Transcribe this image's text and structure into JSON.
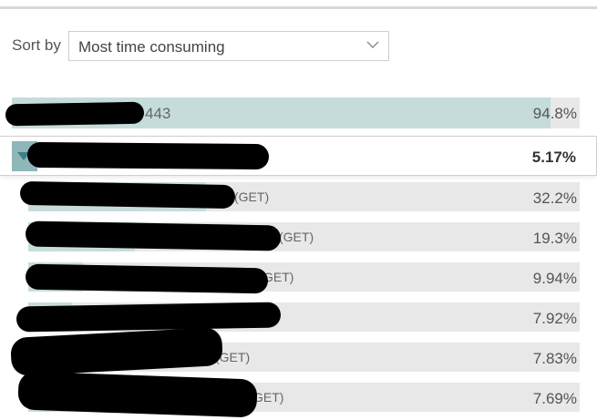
{
  "sort": {
    "label": "Sort by",
    "selected": "Most time consuming",
    "chevron_icon": "chevron-down-icon"
  },
  "rows": [
    {
      "name_visible": "443",
      "percent": "94.8%",
      "fraction": 0.948,
      "kind": "parent"
    },
    {
      "name_visible": "",
      "percent": "5.17%",
      "fraction": 0.0517,
      "kind": "selected-parent",
      "toggle_icon": "expand-triangle-icon"
    },
    {
      "name_visible": "(GET)",
      "percent": "32.2%",
      "fraction": 0.322,
      "kind": "child"
    },
    {
      "name_visible": "(GET)",
      "percent": "19.3%",
      "fraction": 0.193,
      "kind": "child"
    },
    {
      "name_visible": "GET)",
      "percent": "9.94%",
      "fraction": 0.0994,
      "kind": "child"
    },
    {
      "name_visible": "",
      "percent": "7.92%",
      "fraction": 0.0792,
      "kind": "child"
    },
    {
      "name_visible": "(GET)",
      "percent": "7.83%",
      "fraction": 0.0783,
      "kind": "child"
    },
    {
      "name_visible": "GET)",
      "percent": "7.69%",
      "fraction": 0.0769,
      "kind": "child"
    }
  ],
  "colors": {
    "bar_fill": "#c6dcdb",
    "bar_track": "#e8e8e8",
    "toggle": "#8fb6b8",
    "redaction": "#000000"
  }
}
